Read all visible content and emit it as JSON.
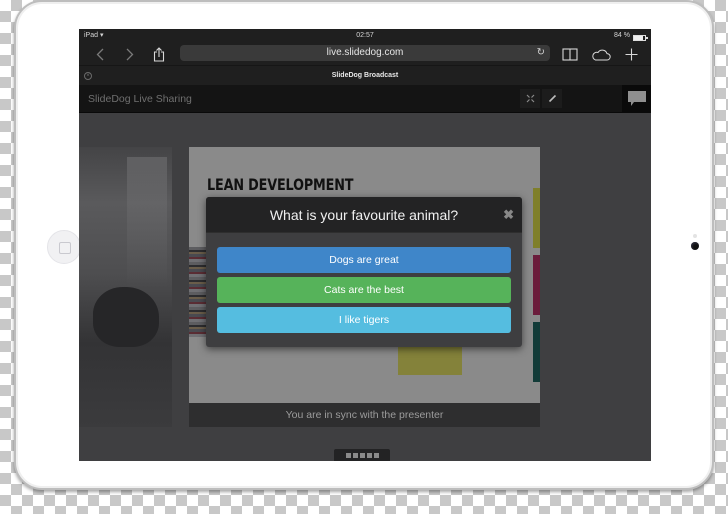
{
  "status_bar": {
    "device": "iPad",
    "time": "02:57",
    "battery_text": "84 %",
    "battery_level": 0.84
  },
  "browser": {
    "url": "live.slidedog.com",
    "tab_title": "SlideDog Broadcast",
    "icons": {
      "back": "chevron-left-icon",
      "forward": "chevron-right-icon",
      "share": "share-icon",
      "reload": "reload-icon",
      "bookmarks": "book-icon",
      "cloud": "cloud-icon",
      "new_tab": "plus-icon",
      "close_tab": "close-circle-icon"
    }
  },
  "app": {
    "title": "SlideDog Live Sharing",
    "icons": {
      "fullscreen": "fullscreen-icon",
      "pen": "pen-icon",
      "chat": "chat-bubble-icon"
    }
  },
  "slide": {
    "title": "LEAN DEVELOPMENT",
    "stripe_colors": [
      "#7f7f2a",
      "#6b1c3b",
      "#123b38"
    ],
    "sticky_color": "#84823a"
  },
  "poll": {
    "question": "What is your favourite animal?",
    "close_symbol": "✖",
    "options": [
      {
        "label": "Dogs are great",
        "color": "#3f86c9"
      },
      {
        "label": "Cats are the best",
        "color": "#56b35a"
      },
      {
        "label": "I like tigers",
        "color": "#55bde0"
      }
    ]
  },
  "sync_status": "You are in sync with the presenter",
  "pager": {
    "count": 5
  }
}
